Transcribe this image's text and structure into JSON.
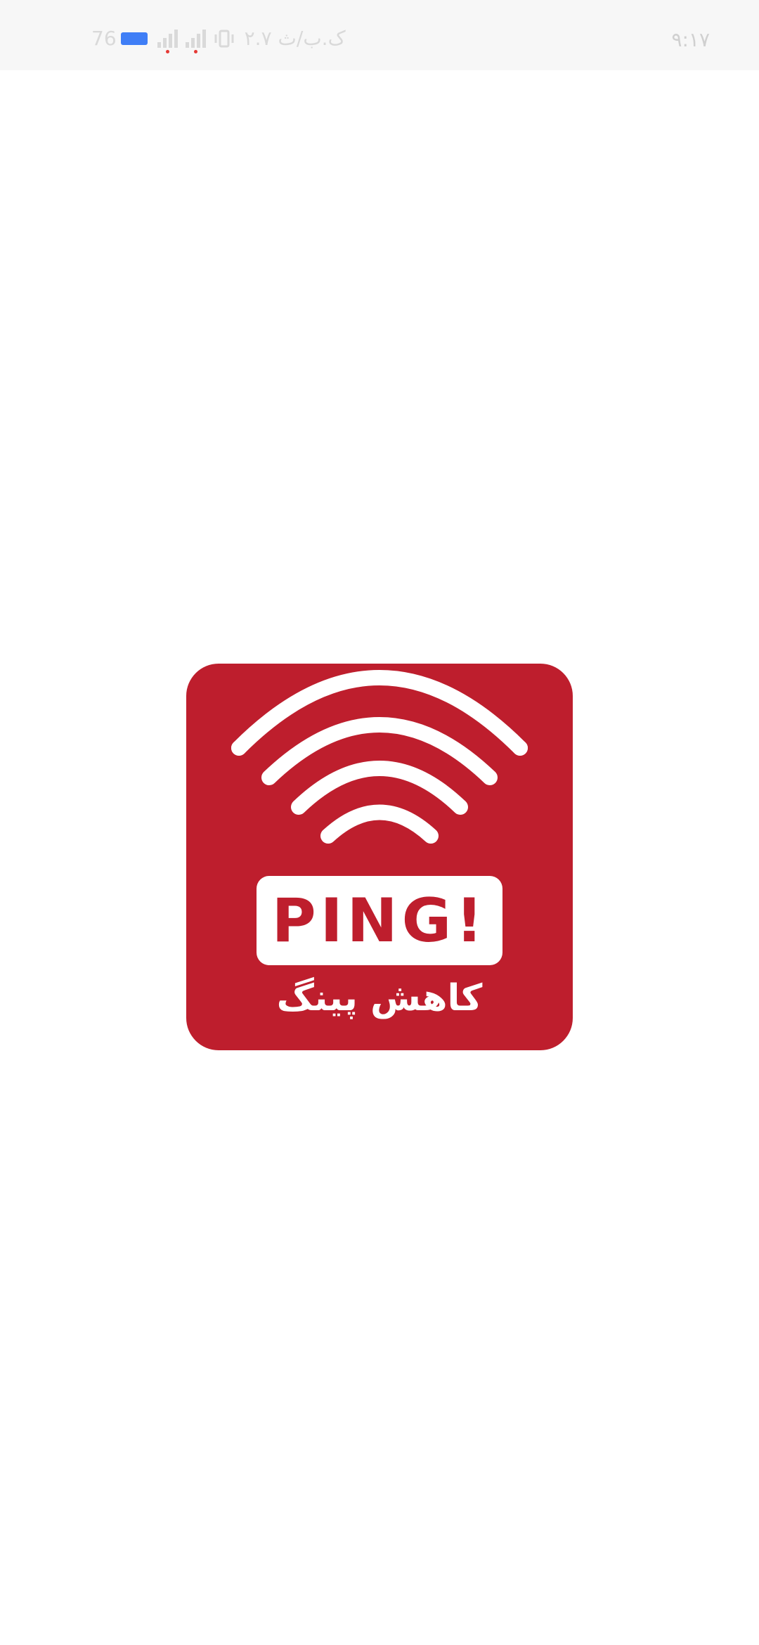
{
  "status_bar": {
    "battery": "76",
    "speed": "۲.۷ ک.ب/ث",
    "time": "۹:۱۷",
    "battery_color": "#3f7ef6"
  },
  "logo": {
    "title": "PING!",
    "caption": "کاهش پینگ",
    "background_color": "#be1e2d",
    "icon": "wifi-signal-icon"
  }
}
